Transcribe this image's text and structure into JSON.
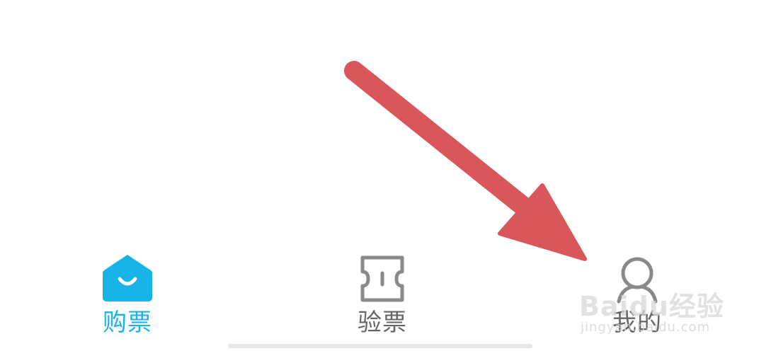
{
  "tab_bar": {
    "items": [
      {
        "label": "购票",
        "icon": "ticket-shop-icon",
        "active": true
      },
      {
        "label": "验票",
        "icon": "ticket-check-icon",
        "active": false
      },
      {
        "label": "我的",
        "icon": "user-icon",
        "active": false
      }
    ]
  },
  "watermark": {
    "brand": "Baidu经验",
    "sub": "jingyan.baidu.com"
  },
  "colors": {
    "active": "#18b4e8",
    "inactive": "#666666",
    "icon_inactive": "#8a8a8a",
    "arrow": "#d9565b"
  }
}
